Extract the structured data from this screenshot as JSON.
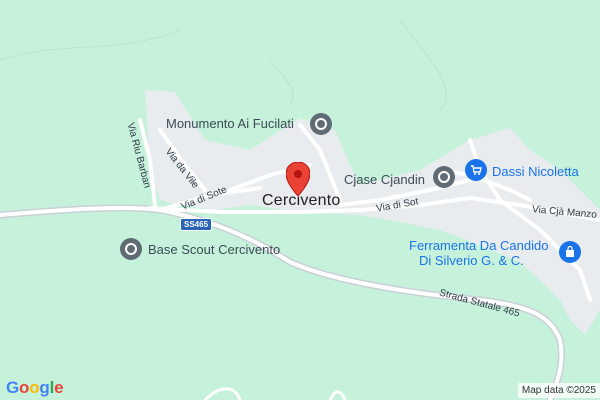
{
  "map": {
    "place": "Cercivento",
    "background_color": "#c6f2dc",
    "developed_area_color": "#e8ecef",
    "road_color": "#ffffff",
    "highway_color": "#c9d0d6"
  },
  "roads": {
    "via_riu_barban": "Via Riu Barban",
    "via_da_vile": "Via da Vile",
    "via_di_sote": "Via di Sote",
    "via_di_sot": "Via di Sot",
    "via_cja_manzoni": "Via Cjà Manzo",
    "highway_shield": "SS465",
    "strada_statale": "Strada Statale 465"
  },
  "pois": {
    "monumento": {
      "label": "Monumento Ai Fucilati",
      "icon": "landmark-icon"
    },
    "cjase": {
      "label": "Cjase Cjandin",
      "icon": "landmark-icon"
    },
    "dassi": {
      "label": "Dassi Nicoletta",
      "icon": "shopping-cart-icon"
    },
    "ferramenta": {
      "line1": "Ferramenta Da Candido",
      "line2": "Di Silverio G. & C.",
      "icon": "shopping-bag-icon"
    },
    "base_scout": {
      "label": "Base Scout Cercivento",
      "icon": "landmark-icon"
    }
  },
  "brand": {
    "google": [
      "G",
      "o",
      "o",
      "g",
      "l",
      "e"
    ],
    "google_colors": [
      "#4285f4",
      "#ea4335",
      "#fbbc05",
      "#4285f4",
      "#34a853",
      "#ea4335"
    ]
  },
  "attribution": "Map data ©2025"
}
